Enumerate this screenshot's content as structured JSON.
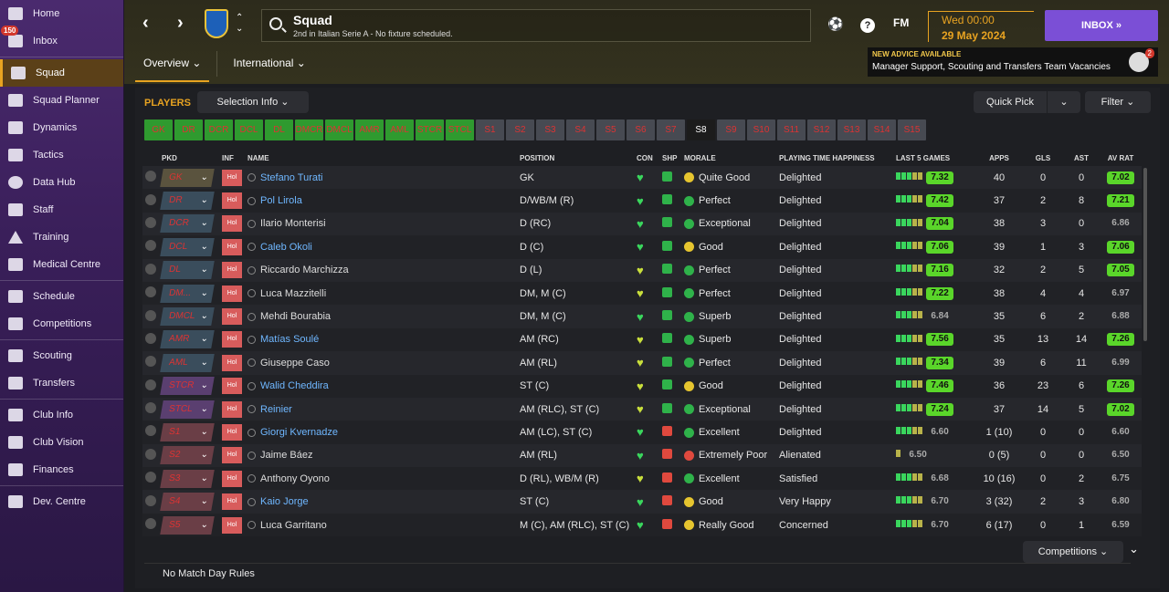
{
  "sidebar": {
    "items": [
      {
        "label": "Home",
        "icon": "home-icon"
      },
      {
        "label": "Inbox",
        "icon": "inbox-icon",
        "badge": "150"
      },
      {
        "label": "Squad",
        "icon": "squad-icon",
        "active": true
      },
      {
        "label": "Squad Planner",
        "icon": "planner-icon"
      },
      {
        "label": "Dynamics",
        "icon": "dynamics-icon"
      },
      {
        "label": "Tactics",
        "icon": "tactics-icon"
      },
      {
        "label": "Data Hub",
        "icon": "datahub-icon"
      },
      {
        "label": "Staff",
        "icon": "staff-icon"
      },
      {
        "label": "Training",
        "icon": "training-icon"
      },
      {
        "label": "Medical Centre",
        "icon": "medical-icon"
      },
      {
        "label": "Schedule",
        "icon": "schedule-icon"
      },
      {
        "label": "Competitions",
        "icon": "trophy-icon"
      },
      {
        "label": "Scouting",
        "icon": "scouting-icon"
      },
      {
        "label": "Transfers",
        "icon": "transfers-icon"
      },
      {
        "label": "Club Info",
        "icon": "club-info-icon"
      },
      {
        "label": "Club Vision",
        "icon": "club-vision-icon"
      },
      {
        "label": "Finances",
        "icon": "finances-icon"
      },
      {
        "label": "Dev. Centre",
        "icon": "dev-centre-icon"
      }
    ]
  },
  "header": {
    "title": "Squad",
    "subtitle": "2nd in Italian Serie A - No fixture scheduled.",
    "fm": "FM",
    "help": "?",
    "date_line1": "Wed 00:00",
    "date_line2": "29 May 2024",
    "inbox": "INBOX  »"
  },
  "tabs": {
    "overview": "Overview ⌄",
    "international": "International ⌄"
  },
  "advice": {
    "title": "NEW ADVICE AVAILABLE",
    "text": "Manager Support, Scouting and Transfers Team Vacancies",
    "count": "2"
  },
  "main": {
    "players_label": "PLAYERS",
    "selection_info": "Selection Info  ⌄",
    "quick_pick": "Quick Pick",
    "quick_pick_arrow": "⌄",
    "filter": "Filter  ⌄",
    "positions": [
      "GK",
      "DR",
      "DCR",
      "DCL",
      "DL",
      "DMCR",
      "DMCL",
      "AMR",
      "AML",
      "STCR",
      "STCL",
      "S1",
      "S2",
      "S3",
      "S4",
      "S5",
      "S6",
      "S7",
      "S8",
      "S9",
      "S10",
      "S11",
      "S12",
      "S13",
      "S14",
      "S15"
    ],
    "columns": [
      "PKD",
      "INF",
      "NAME",
      "POSITION",
      "CON",
      "SHP",
      "MORALE",
      "PLAYING TIME HAPPINESS",
      "LAST 5 GAMES",
      "APPS",
      "GLS",
      "AST",
      "AV RAT"
    ],
    "competitions": "Competitions  ⌄",
    "footer": "No Match Day Rules"
  },
  "players": [
    {
      "pkd": "GK",
      "inf": "Hol",
      "name": "Stefano Turati",
      "link": true,
      "pos": "GK",
      "morale": "Quite Good",
      "happy": "Delighted",
      "form": "7.32",
      "apps": "40",
      "gls": "0",
      "ast": "0",
      "rat": "7.02",
      "ratgood": true
    },
    {
      "pkd": "DR",
      "inf": "Hol",
      "name": "Pol Lirola",
      "link": true,
      "pos": "D/WB/M (R)",
      "morale": "Perfect",
      "happy": "Delighted",
      "form": "7.42",
      "apps": "37",
      "gls": "2",
      "ast": "8",
      "rat": "7.21",
      "ratgood": true
    },
    {
      "pkd": "DCR",
      "inf": "Hol",
      "name": "Ilario Monterisi",
      "link": false,
      "pos": "D (RC)",
      "morale": "Exceptional",
      "happy": "Delighted",
      "form": "7.04",
      "apps": "38",
      "gls": "3",
      "ast": "0",
      "rat": "6.86",
      "ratgood": false
    },
    {
      "pkd": "DCL",
      "inf": "Hol",
      "name": "Caleb Okoli",
      "link": true,
      "pos": "D (C)",
      "morale": "Good",
      "happy": "Delighted",
      "form": "7.06",
      "apps": "39",
      "gls": "1",
      "ast": "3",
      "rat": "7.06",
      "ratgood": true
    },
    {
      "pkd": "DL",
      "inf": "Hol",
      "name": "Riccardo Marchizza",
      "link": false,
      "pos": "D (L)",
      "morale": "Perfect",
      "happy": "Delighted",
      "form": "7.16",
      "apps": "32",
      "gls": "2",
      "ast": "5",
      "rat": "7.05",
      "ratgood": true
    },
    {
      "pkd": "DM...",
      "inf": "Hol",
      "name": "Luca Mazzitelli",
      "link": false,
      "pos": "DM, M (C)",
      "morale": "Perfect",
      "happy": "Delighted",
      "form": "7.22",
      "apps": "38",
      "gls": "4",
      "ast": "4",
      "rat": "6.97",
      "ratgood": false
    },
    {
      "pkd": "DMCL",
      "inf": "Hol",
      "name": "Mehdi Bourabia",
      "link": false,
      "pos": "DM, M (C)",
      "morale": "Superb",
      "happy": "Delighted",
      "form": "6.84",
      "apps": "35",
      "gls": "6",
      "ast": "2",
      "rat": "6.88",
      "ratgood": false
    },
    {
      "pkd": "AMR",
      "inf": "Hol",
      "name": "Matías Soulé",
      "link": true,
      "pos": "AM (RC)",
      "morale": "Superb",
      "happy": "Delighted",
      "form": "7.56",
      "apps": "35",
      "gls": "13",
      "ast": "14",
      "rat": "7.26",
      "ratgood": true
    },
    {
      "pkd": "AML",
      "inf": "Hol",
      "name": "Giuseppe Caso",
      "link": false,
      "pos": "AM (RL)",
      "morale": "Perfect",
      "happy": "Delighted",
      "form": "7.34",
      "apps": "39",
      "gls": "6",
      "ast": "11",
      "rat": "6.99",
      "ratgood": false
    },
    {
      "pkd": "STCR",
      "inf": "Hol",
      "name": "Walid Cheddira",
      "link": true,
      "pos": "ST (C)",
      "morale": "Good",
      "happy": "Delighted",
      "form": "7.46",
      "apps": "36",
      "gls": "23",
      "ast": "6",
      "rat": "7.26",
      "ratgood": true
    },
    {
      "pkd": "STCL",
      "inf": "Hol",
      "name": "Reinier",
      "link": true,
      "pos": "AM (RLC), ST (C)",
      "morale": "Exceptional",
      "happy": "Delighted",
      "form": "7.24",
      "apps": "37",
      "gls": "14",
      "ast": "5",
      "rat": "7.02",
      "ratgood": true
    },
    {
      "pkd": "S1",
      "inf": "Hol",
      "name": "Giorgi Kvernadze",
      "link": true,
      "pos": "AM (LC), ST (C)",
      "morale": "Excellent",
      "happy": "Delighted",
      "form": "6.60",
      "apps": "1 (10)",
      "gls": "0",
      "ast": "0",
      "rat": "6.60",
      "ratgood": false
    },
    {
      "pkd": "S2",
      "inf": "Hol",
      "name": "Jaime Báez",
      "link": false,
      "pos": "AM (RL)",
      "morale": "Extremely Poor",
      "happy": "Alienated",
      "form": "6.50",
      "apps": "0 (5)",
      "gls": "0",
      "ast": "0",
      "rat": "6.50",
      "ratgood": false
    },
    {
      "pkd": "S3",
      "inf": "Hol",
      "name": "Anthony Oyono",
      "link": false,
      "pos": "D (RL), WB/M (R)",
      "morale": "Excellent",
      "happy": "Satisfied",
      "form": "6.68",
      "apps": "10 (16)",
      "gls": "0",
      "ast": "2",
      "rat": "6.75",
      "ratgood": false
    },
    {
      "pkd": "S4",
      "inf": "Hol",
      "name": "Kaio Jorge",
      "link": true,
      "pos": "ST (C)",
      "morale": "Good",
      "happy": "Very Happy",
      "form": "6.70",
      "apps": "3 (32)",
      "gls": "2",
      "ast": "3",
      "rat": "6.80",
      "ratgood": false
    },
    {
      "pkd": "S5",
      "inf": "Hol",
      "name": "Luca Garritano",
      "link": false,
      "pos": "M (C), AM (RLC), ST (C)",
      "morale": "Really Good",
      "happy": "Concerned",
      "form": "6.70",
      "apps": "6 (17)",
      "gls": "0",
      "ast": "1",
      "rat": "6.59",
      "ratgood": false
    }
  ]
}
